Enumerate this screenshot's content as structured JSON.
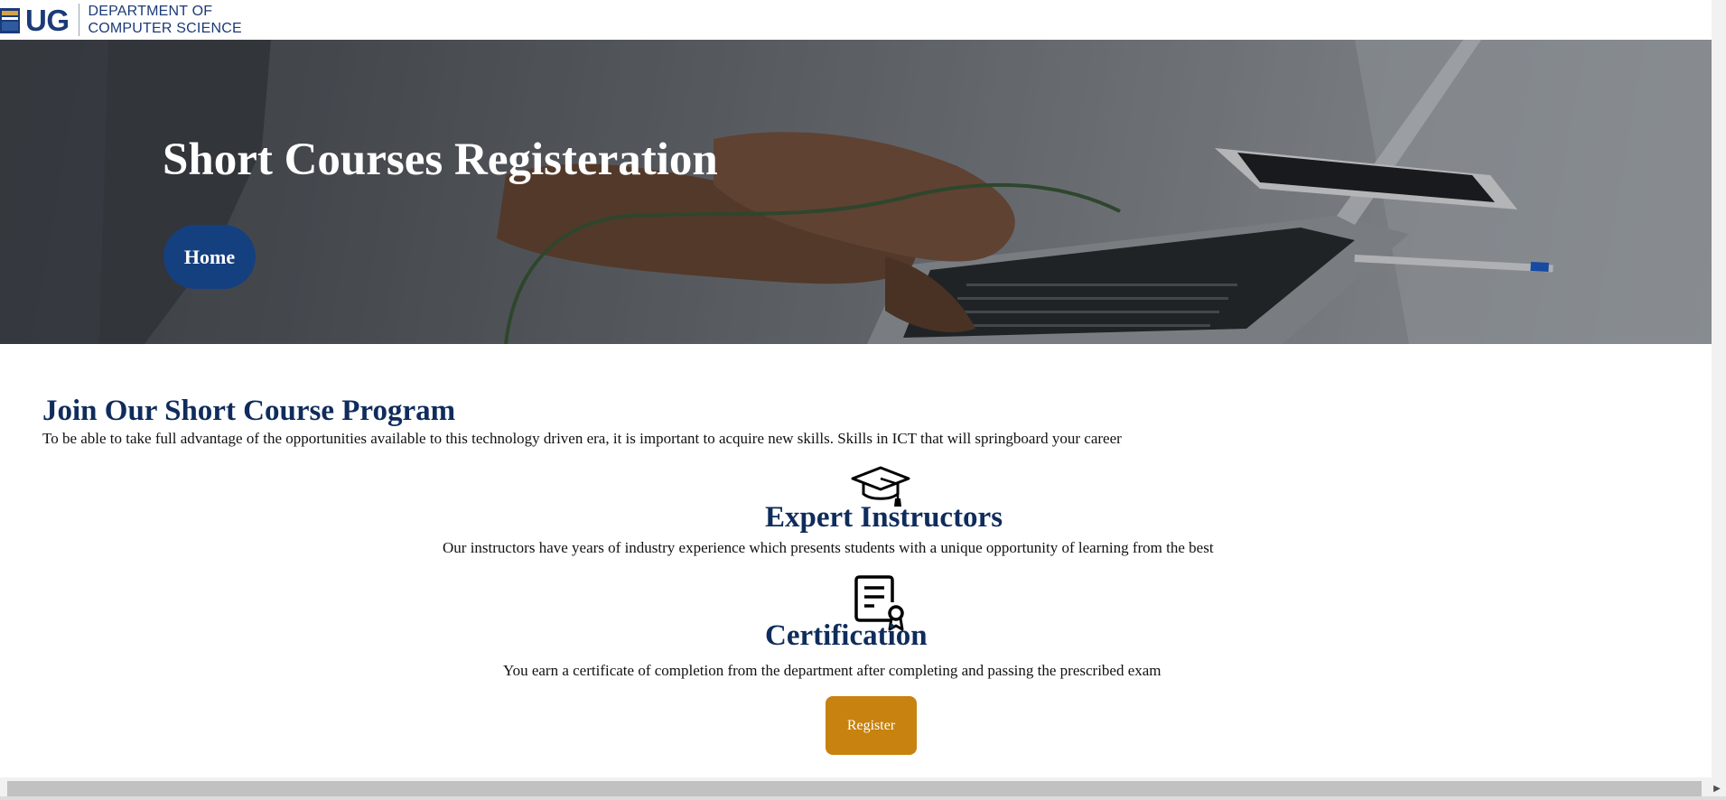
{
  "header": {
    "logo_mark": "UG",
    "logo_line1": "DEPARTMENT OF",
    "logo_line2": "COMPUTER SCIENCE"
  },
  "hero": {
    "title": "Short Courses Registeration",
    "home_label": "Home"
  },
  "main": {
    "section_title": "Join Our Short Course Program",
    "intro": "To be able to take full advantage of the opportunities available to this technology driven era, it is important to acquire new skills. Skills in ICT that will springboard your career",
    "features": [
      {
        "icon": "graduation-cap-icon",
        "title": "Expert Instructors",
        "text": "Our instructors have years of industry experience which presents students with a unique opportunity of learning from the best"
      },
      {
        "icon": "certificate-icon",
        "title": "Certification",
        "text": "You earn a certificate of completion from the department after completing and passing the prescribed exam"
      }
    ],
    "register_label": "Register"
  },
  "colors": {
    "brand_blue": "#15407f",
    "heading_navy": "#0f2c5c",
    "register_gold": "#c7820f"
  }
}
